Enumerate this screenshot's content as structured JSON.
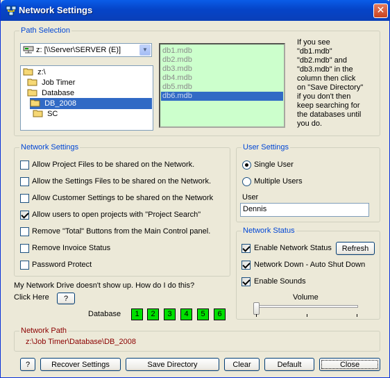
{
  "window": {
    "title": "Network Settings",
    "close_glyph": "✕"
  },
  "path_selection": {
    "legend": "Path Selection",
    "drive": "z: [\\\\Server\\SERVER (E)]",
    "directories": [
      {
        "label": "z:\\",
        "selected": false
      },
      {
        "label": "Job Timer",
        "selected": false
      },
      {
        "label": "Database",
        "selected": false
      },
      {
        "label": "DB_2008",
        "selected": true
      },
      {
        "label": "SC",
        "selected": false
      }
    ],
    "databases": [
      {
        "label": "db1.mdb",
        "selected": false
      },
      {
        "label": "db2.mdb",
        "selected": false
      },
      {
        "label": "db3.mdb",
        "selected": false
      },
      {
        "label": "db4.mdb",
        "selected": false
      },
      {
        "label": "db5.mdb",
        "selected": false
      },
      {
        "label": "db6.mdb",
        "selected": true
      }
    ],
    "note_lines": [
      "If you see",
      "\"db1.mdb\"",
      "\"db2.mdb\" and",
      "\"db3.mdb\" in the",
      "column then click",
      "on \"Save Directory\"",
      "if you don't then",
      "keep searching for",
      "the databases until",
      "you do."
    ]
  },
  "network_settings": {
    "legend": "Network Settings",
    "options": [
      {
        "label": "Allow Project Files to be shared on the Network.",
        "checked": false
      },
      {
        "label": "Allow the Settings Files to be shared on the Network.",
        "checked": false
      },
      {
        "label": "Allow Customer Settings to be shared on the Network",
        "checked": false
      },
      {
        "label": "Allow users to open projects with \"Project Search\"",
        "checked": true
      },
      {
        "label": "Remove \"Total\" Buttons from the Main Control panel.",
        "checked": false
      },
      {
        "label": "Remove Invoice Status",
        "checked": false
      },
      {
        "label": "Password Protect",
        "checked": false
      }
    ]
  },
  "help": {
    "question": "My Network Drive doesn't show up. How do I do this?",
    "click_here": "Click Here",
    "help_button": "?"
  },
  "database_selector": {
    "label": "Database",
    "buttons": [
      "1",
      "2",
      "3",
      "4",
      "5",
      "6"
    ],
    "color": "#00e000"
  },
  "user_settings": {
    "legend": "User Settings",
    "single_user": "Single User",
    "multiple_users": "Multiple Users",
    "mode": "single",
    "user_label": "User",
    "user_value": "Dennis"
  },
  "network_status": {
    "legend": "Network Status",
    "enable_network_status": "Enable Network Status",
    "refresh": "Refresh",
    "network_down": "Network Down - Auto Shut Down",
    "enable_sounds": "Enable Sounds",
    "volume_label": "Volume",
    "volume_level": 0.0
  },
  "network_path": {
    "legend": "Network Path",
    "value": "z:\\Job Timer\\Database\\DB_2008"
  },
  "bottom_buttons": {
    "help": "?",
    "recover": "Recover Settings",
    "save": "Save Directory",
    "clear": "Clear",
    "default": "Default",
    "close": "Close"
  }
}
